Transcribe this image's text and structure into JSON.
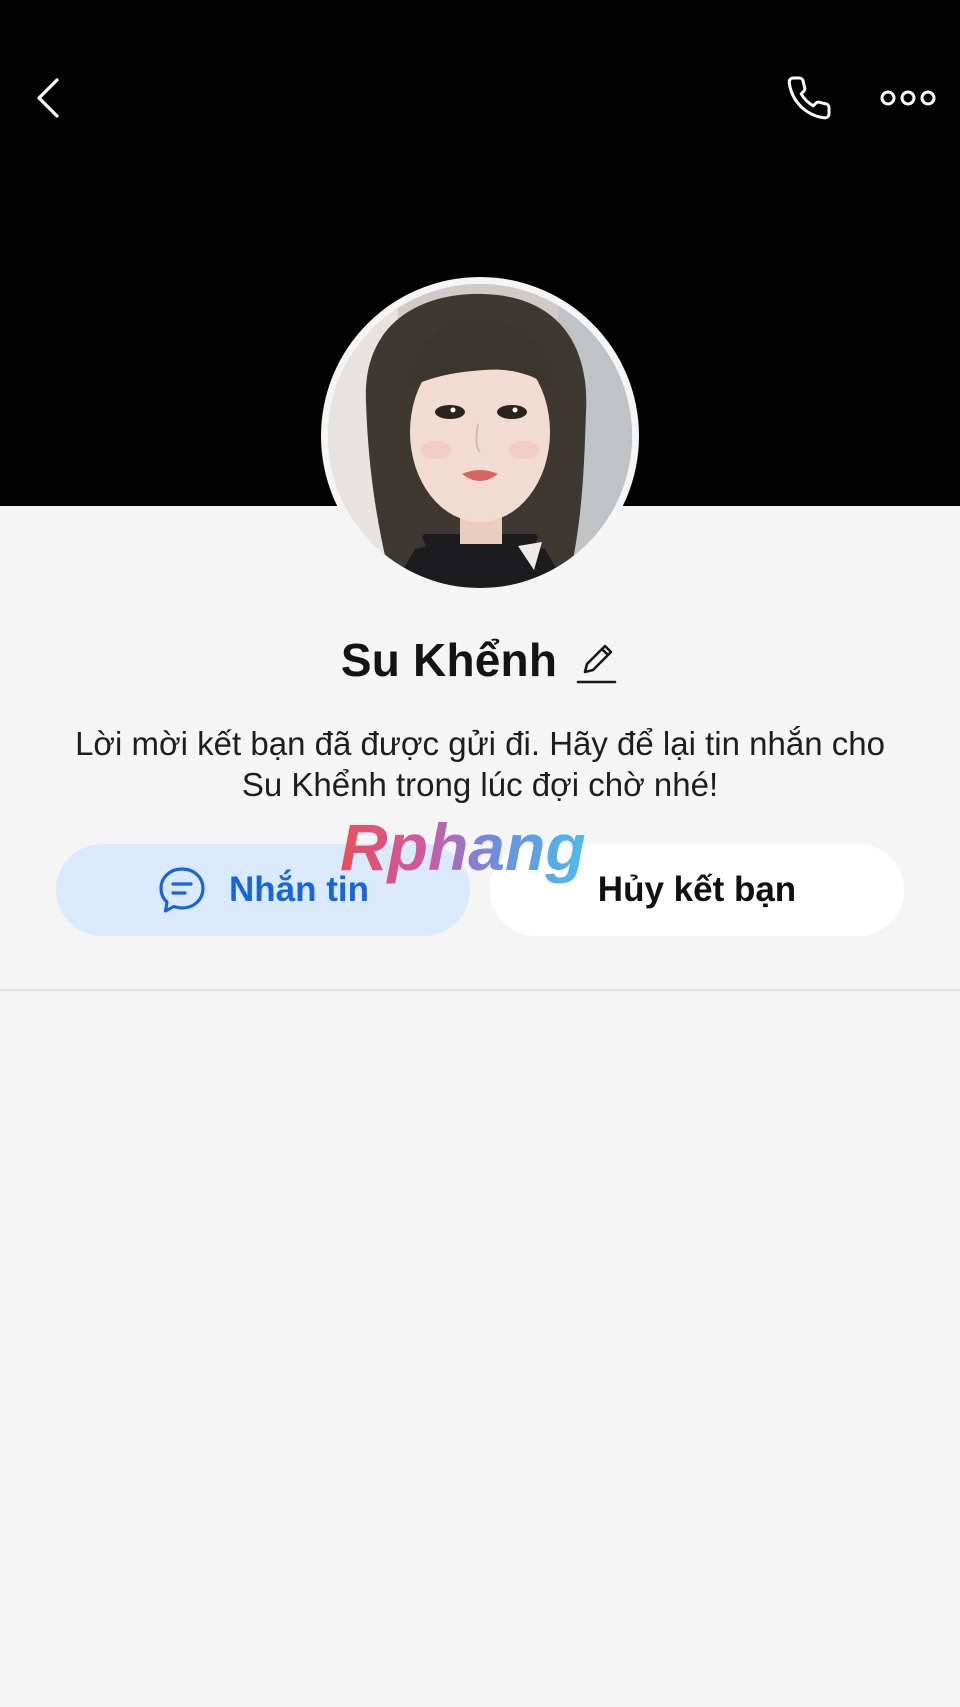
{
  "profile": {
    "name": "Su Khểnh",
    "status_message": "Lời mời kết bạn đã được gửi đi. Hãy để lại tin nhắn cho Su Khểnh trong lúc đợi chờ nhé!"
  },
  "header": {
    "icons": [
      "back-arrow-icon",
      "phone-icon",
      "more-options-icon"
    ]
  },
  "actions": {
    "message_label": "Nhắn tin",
    "message_icon": "chat-bubble-icon",
    "unfriend_label": "Hủy kết bạn"
  },
  "watermark": {
    "text": "Rphang"
  },
  "colors": {
    "cover_background": "#020202",
    "page_background": "#f5f5f5",
    "accent_blue": "#1666d9",
    "message_button_bg": "#dbe9fd",
    "unfriend_button_bg": "#ffffff"
  }
}
